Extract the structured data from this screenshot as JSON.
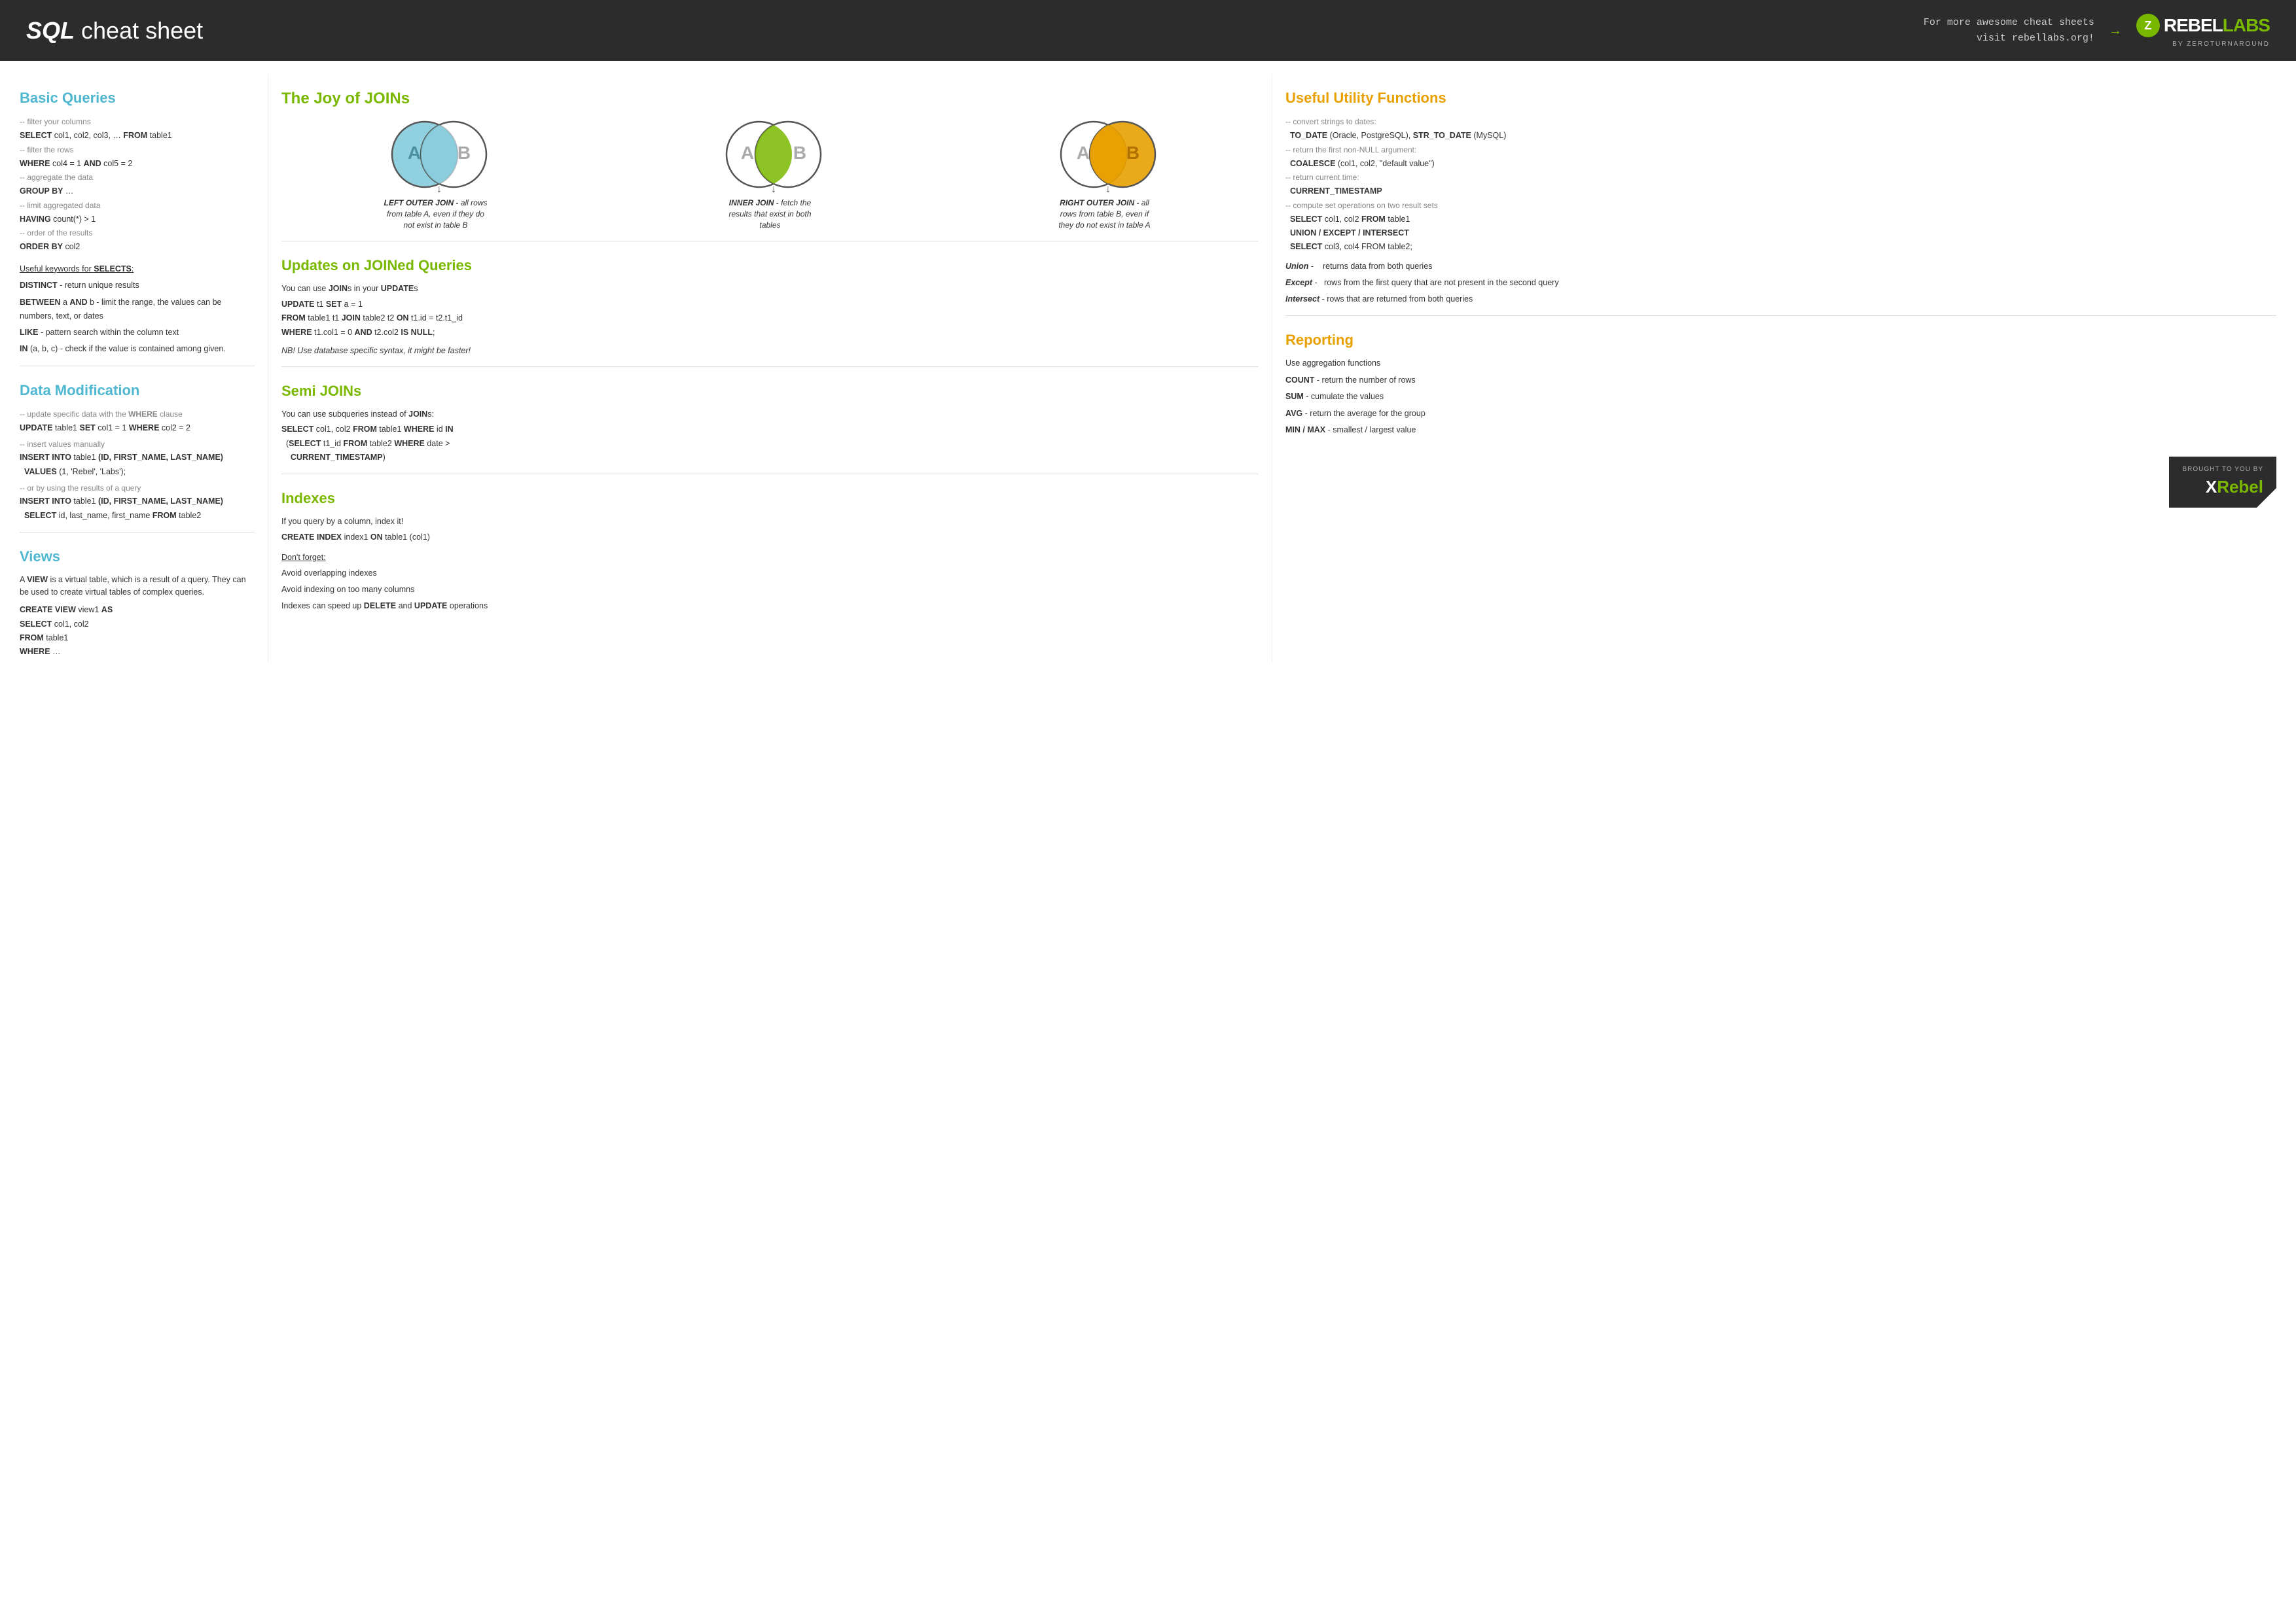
{
  "header": {
    "title_bold": "SQL",
    "title_rest": " cheat sheet",
    "tagline_line1": "For more awesome cheat sheets",
    "tagline_line2": "visit rebellabs.org!",
    "logo_letter": "Z",
    "logo_text_white": "REBEL",
    "logo_text_green": "LABS",
    "logo_sub": "BY ZEROTURNAROUND"
  },
  "basic_queries": {
    "title": "Basic Queries",
    "items": [
      {
        "comment": "-- filter your columns",
        "code": "SELECT col1, col2, col3, … FROM table1"
      },
      {
        "comment": "-- filter the rows",
        "code": "WHERE col4 = 1 AND col5 = 2"
      },
      {
        "comment": "-- aggregate the data",
        "code": "GROUP by …"
      },
      {
        "comment": "-- limit aggregated data",
        "code": "HAVING count(*) > 1"
      },
      {
        "comment": "-- order of the results",
        "code": "ORDER BY col2"
      }
    ],
    "keywords_label": "Useful keywords for SELECTS:",
    "keywords": [
      {
        "kw": "DISTINCT",
        "desc": " - return unique results"
      },
      {
        "kw": "BETWEEN",
        "mid": " a AND b - limit the range, the values can be numbers, text, or dates",
        "desc": ""
      },
      {
        "kw": "LIKE",
        "desc": " - pattern search within the column text"
      },
      {
        "kw": "IN",
        "desc": " (a, b, c) - check if the value is contained among given."
      }
    ]
  },
  "data_modification": {
    "title": "Data Modification",
    "items": [
      {
        "comment": "-- update specific data with the WHERE clause",
        "code": "UPDATE table1 SET col1 = 1 WHERE col2 = 2"
      },
      {
        "comment": "-- insert values manually",
        "code": "INSERT INTO table1 (ID, FIRST_NAME, LAST_NAME)\n  VALUES (1, 'Rebel', 'Labs');"
      },
      {
        "comment": "-- or by using the results of a query",
        "code": "INSERT INTO table1 (ID, FIRST_NAME, LAST_NAME)\n  SELECT id, last_name, first_name FROM table2"
      }
    ]
  },
  "views": {
    "title": "Views",
    "desc": "A VIEW is a virtual table, which is a result  of a query. They can be used to create virtual tables of complex queries.",
    "code": "CREATE VIEW view1 AS\nSELECT col1, col2\nFROM table1\nWHERE …"
  },
  "joins": {
    "title": "The Joy of JOINs",
    "diagrams": [
      {
        "type": "left_outer",
        "label_kw": "LEFT OUTER JOIN -",
        "label_rest": " all rows from table A, even if they do not exist in table B"
      },
      {
        "type": "inner",
        "label_kw": "INNER JOIN -",
        "label_rest": " fetch the results that exist in both tables"
      },
      {
        "type": "right_outer",
        "label_kw": "RIGHT OUTER JOIN -",
        "label_rest": " all rows from table B, even if they do not exist in table A"
      }
    ]
  },
  "updates_joined": {
    "title": "Updates on JOINed Queries",
    "desc": "You can use JOINs in your UPDATEs",
    "code": "UPDATE t1 SET a = 1\nFROM table1 t1 JOIN table2 t2 ON t1.id = t2.t1_id\nWHERE t1.col1 = 0 AND t2.col2 IS NULL;",
    "note": "NB! Use database specific syntax, it might be faster!"
  },
  "semi_joins": {
    "title": "Semi JOINs",
    "desc": "You can use subqueries instead of JOINs:",
    "code": "SELECT col1, col2 FROM table1 WHERE id IN\n  (SELECT t1_id FROM table2 WHERE date >\n    CURRENT_TIMESTAMP)"
  },
  "indexes": {
    "title": "Indexes",
    "desc": "If you query by a column, index it!",
    "code": "CREATE INDEX index1 ON table1 (col1)",
    "dont_forget_label": "Don't forget:",
    "dont_forget_items": [
      "Avoid overlapping indexes",
      "Avoid indexing on too many columns",
      "Indexes can speed up DELETE and UPDATE operations"
    ]
  },
  "utility_functions": {
    "title": "Useful Utility Functions",
    "items": [
      {
        "comment": "-- convert strings to dates:",
        "code": "TO_DATE (Oracle, PostgreSQL), STR_TO_DATE (MySQL)"
      },
      {
        "comment": "-- return the first non-NULL argument:",
        "code": "COALESCE (col1, col2, \"default value\")"
      },
      {
        "comment": "-- return current time:",
        "code": "CURRENT_TIMESTAMP"
      },
      {
        "comment": "-- compute set operations on two result sets",
        "code": "SELECT col1, col2 FROM table1\nUNION / EXCEPT / INTERSECT\nSELECT col3, col4 FROM table2;"
      }
    ],
    "set_ops": [
      {
        "kw": "Union",
        "desc": " -    returns data from both queries"
      },
      {
        "kw": "Except",
        "desc": " -   rows from the first query that are not present in the second query"
      },
      {
        "kw": "Intersect",
        "desc": " - rows that are returned from both queries"
      }
    ]
  },
  "reporting": {
    "title": "Reporting",
    "desc": "Use aggregation functions",
    "items": [
      {
        "kw": "COUNT",
        "desc": " - return the number of rows"
      },
      {
        "kw": "SUM",
        "desc": " - cumulate the values"
      },
      {
        "kw": "AVG",
        "desc": " - return the average for the group"
      },
      {
        "kw": "MIN / MAX",
        "desc": " - smallest / largest value"
      }
    ]
  },
  "footer": {
    "brought_by": "BROUGHT TO YOU BY",
    "xrebel_x": "X",
    "xrebel_text": "Rebel"
  }
}
